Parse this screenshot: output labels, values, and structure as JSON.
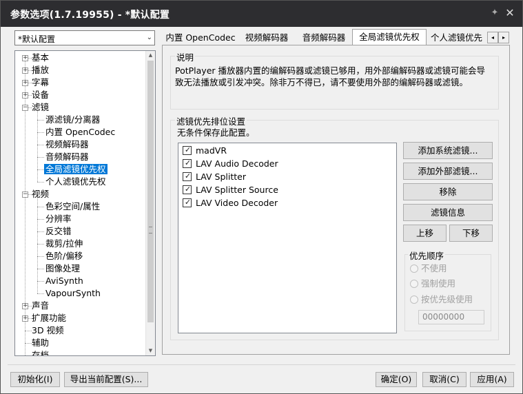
{
  "window": {
    "title": "参数选项(1.7.19955) - *默认配置",
    "pin_glyph": "✦",
    "close_glyph": "✕"
  },
  "profile": {
    "value": "*默认配置",
    "arrow": "⌄"
  },
  "tree": {
    "items": [
      {
        "label": "基本",
        "expander": "+"
      },
      {
        "label": "播放",
        "expander": "+"
      },
      {
        "label": "字幕",
        "expander": "+"
      },
      {
        "label": "设备",
        "expander": "+"
      },
      {
        "label": "滤镜",
        "expander": "−"
      },
      {
        "label": "源滤镜/分离器"
      },
      {
        "label": "内置 OpenCodec"
      },
      {
        "label": "视频解码器"
      },
      {
        "label": "音频解码器"
      },
      {
        "label": "全局滤镜优先权"
      },
      {
        "label": "个人滤镜优先权"
      },
      {
        "label": "视频",
        "expander": "−"
      },
      {
        "label": "色彩空间/属性"
      },
      {
        "label": "分辨率"
      },
      {
        "label": "反交错"
      },
      {
        "label": "裁剪/拉伸"
      },
      {
        "label": "色阶/偏移"
      },
      {
        "label": "图像处理"
      },
      {
        "label": "AviSynth"
      },
      {
        "label": "VapourSynth"
      },
      {
        "label": "声音",
        "expander": "+"
      },
      {
        "label": "扩展功能",
        "expander": "+"
      },
      {
        "label": "3D 视频"
      },
      {
        "label": "辅助"
      },
      {
        "label": "存档"
      }
    ]
  },
  "tabs": [
    {
      "label": "内置 OpenCodec"
    },
    {
      "label": "视频解码器"
    },
    {
      "label": "音频解码器"
    },
    {
      "label": "全局滤镜优先权"
    },
    {
      "label": "个人滤镜优先"
    }
  ],
  "tab_scroll": {
    "left": "◂",
    "right": "▸"
  },
  "description": {
    "title": "说明",
    "text": "PotPlayer 播放器内置的编解码器或滤镜已够用，用外部编解码器或滤镜可能会导致无法播放或引发冲突。除非万不得已，请不要使用外部的编解码器或滤镜。"
  },
  "priority_settings": {
    "title": "滤镜优先排位设置",
    "note": "无条件保存此配置。",
    "filters": [
      {
        "name": "madVR",
        "checked": true
      },
      {
        "name": "LAV Audio Decoder",
        "checked": true
      },
      {
        "name": "LAV Splitter",
        "checked": true
      },
      {
        "name": "LAV Splitter Source",
        "checked": true
      },
      {
        "name": "LAV Video Decoder",
        "checked": true
      }
    ],
    "check_glyph": "✓",
    "buttons": {
      "add_system": "添加系统滤镜...",
      "add_external": "添加外部滤镜...",
      "remove": "移除",
      "info": "滤镜信息",
      "up": "上移",
      "down": "下移"
    },
    "order": {
      "title": "优先顺序",
      "options": [
        "不使用",
        "强制使用",
        "按优先级使用"
      ],
      "value": "00000000"
    }
  },
  "footer": {
    "init": "初始化(I)",
    "export": "导出当前配置(S)...",
    "ok": "确定(O)",
    "cancel": "取消(C)",
    "apply": "应用(A)"
  }
}
